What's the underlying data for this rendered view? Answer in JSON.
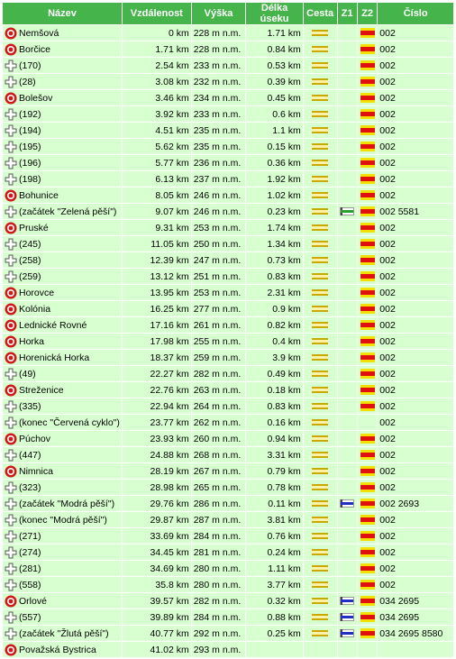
{
  "headers": {
    "nazev": "Název",
    "vzdalenost": "Vzdálenost",
    "vyska": "Výška",
    "delka_useku": "Délka úseku",
    "cesta": "Cesta",
    "z1": "Z1",
    "z2": "Z2",
    "cislo": "Číslo"
  },
  "colors": {
    "header_bg": "#45b44a",
    "row_bg": "#d8ffd0",
    "town_red": "#d01818",
    "road_yellow": "#c9a800",
    "route_red": "#e01010",
    "mark_green": "#2ca02c",
    "mark_blue": "#2030c0",
    "mark_yellow": "#f2e000",
    "mark_red": "#e01010"
  },
  "rows": [
    {
      "icon": "town",
      "name": "Nemšová",
      "distance": "0 km",
      "altitude": "228 m n.m.",
      "segment": "1.71 km",
      "road": true,
      "z1": "",
      "z2": "red",
      "number": "002"
    },
    {
      "icon": "town",
      "name": "Borčice",
      "distance": "1.71 km",
      "altitude": "228 m n.m.",
      "segment": "0.84 km",
      "road": true,
      "z1": "",
      "z2": "red",
      "number": "002"
    },
    {
      "icon": "junction",
      "name": "(170)",
      "distance": "2.54 km",
      "altitude": "233 m n.m.",
      "segment": "0.53 km",
      "road": true,
      "z1": "",
      "z2": "red",
      "number": "002"
    },
    {
      "icon": "junction",
      "name": "(28)",
      "distance": "3.08 km",
      "altitude": "232 m n.m.",
      "segment": "0.39 km",
      "road": true,
      "z1": "",
      "z2": "red",
      "number": "002"
    },
    {
      "icon": "town",
      "name": "Bolešov",
      "distance": "3.46 km",
      "altitude": "234 m n.m.",
      "segment": "0.45 km",
      "road": true,
      "z1": "",
      "z2": "red",
      "number": "002"
    },
    {
      "icon": "junction",
      "name": "(192)",
      "distance": "3.92 km",
      "altitude": "233 m n.m.",
      "segment": "0.6 km",
      "road": true,
      "z1": "",
      "z2": "red",
      "number": "002"
    },
    {
      "icon": "junction",
      "name": "(194)",
      "distance": "4.51 km",
      "altitude": "235 m n.m.",
      "segment": "1.1 km",
      "road": true,
      "z1": "",
      "z2": "red",
      "number": "002"
    },
    {
      "icon": "junction",
      "name": "(195)",
      "distance": "5.62 km",
      "altitude": "235 m n.m.",
      "segment": "0.15 km",
      "road": true,
      "z1": "",
      "z2": "red",
      "number": "002"
    },
    {
      "icon": "junction",
      "name": "(196)",
      "distance": "5.77 km",
      "altitude": "236 m n.m.",
      "segment": "0.36 km",
      "road": true,
      "z1": "",
      "z2": "red",
      "number": "002"
    },
    {
      "icon": "junction",
      "name": "(198)",
      "distance": "6.13 km",
      "altitude": "237 m n.m.",
      "segment": "1.92 km",
      "road": true,
      "z1": "",
      "z2": "red",
      "number": "002"
    },
    {
      "icon": "town",
      "name": "Bohunice",
      "distance": "8.05 km",
      "altitude": "246 m n.m.",
      "segment": "1.02 km",
      "road": true,
      "z1": "",
      "z2": "red",
      "number": "002"
    },
    {
      "icon": "junction",
      "name": "(začátek \"Zelená pěší\")",
      "distance": "9.07 km",
      "altitude": "246 m n.m.",
      "segment": "0.23 km",
      "road": true,
      "z1": "green",
      "z2": "red",
      "number": "002 5581"
    },
    {
      "icon": "town",
      "name": "Pruské",
      "distance": "9.31 km",
      "altitude": "253 m n.m.",
      "segment": "1.74 km",
      "road": true,
      "z1": "",
      "z2": "red",
      "number": "002"
    },
    {
      "icon": "junction",
      "name": "(245)",
      "distance": "11.05 km",
      "altitude": "250 m n.m.",
      "segment": "1.34 km",
      "road": true,
      "z1": "",
      "z2": "red",
      "number": "002"
    },
    {
      "icon": "junction",
      "name": "(258)",
      "distance": "12.39 km",
      "altitude": "247 m n.m.",
      "segment": "0.73 km",
      "road": true,
      "z1": "",
      "z2": "red",
      "number": "002"
    },
    {
      "icon": "junction",
      "name": "(259)",
      "distance": "13.12 km",
      "altitude": "251 m n.m.",
      "segment": "0.83 km",
      "road": true,
      "z1": "",
      "z2": "red",
      "number": "002"
    },
    {
      "icon": "town",
      "name": "Horovce",
      "distance": "13.95 km",
      "altitude": "253 m n.m.",
      "segment": "2.31 km",
      "road": true,
      "z1": "",
      "z2": "red",
      "number": "002"
    },
    {
      "icon": "town",
      "name": "Kolónia",
      "distance": "16.25 km",
      "altitude": "277 m n.m.",
      "segment": "0.9 km",
      "road": true,
      "z1": "",
      "z2": "red",
      "number": "002"
    },
    {
      "icon": "town",
      "name": "Lednické Rovné",
      "distance": "17.16 km",
      "altitude": "261 m n.m.",
      "segment": "0.82 km",
      "road": true,
      "z1": "",
      "z2": "red",
      "number": "002"
    },
    {
      "icon": "town",
      "name": "Horka",
      "distance": "17.98 km",
      "altitude": "255 m n.m.",
      "segment": "0.4 km",
      "road": true,
      "z1": "",
      "z2": "red",
      "number": "002"
    },
    {
      "icon": "town",
      "name": "Horenická Horka",
      "distance": "18.37 km",
      "altitude": "259 m n.m.",
      "segment": "3.9 km",
      "road": true,
      "z1": "",
      "z2": "red",
      "number": "002"
    },
    {
      "icon": "junction",
      "name": "(49)",
      "distance": "22.27 km",
      "altitude": "282 m n.m.",
      "segment": "0.49 km",
      "road": true,
      "z1": "",
      "z2": "red",
      "number": "002"
    },
    {
      "icon": "town",
      "name": "Streženice",
      "distance": "22.76 km",
      "altitude": "263 m n.m.",
      "segment": "0.18 km",
      "road": true,
      "z1": "",
      "z2": "red",
      "number": "002"
    },
    {
      "icon": "junction",
      "name": "(335)",
      "distance": "22.94 km",
      "altitude": "264 m n.m.",
      "segment": "0.83 km",
      "road": true,
      "z1": "",
      "z2": "red",
      "number": "002"
    },
    {
      "icon": "junction",
      "name": "(konec \"Červená cyklo\")",
      "distance": "23.77 km",
      "altitude": "262 m n.m.",
      "segment": "0.16 km",
      "road": true,
      "z1": "",
      "z2": "",
      "number": "002"
    },
    {
      "icon": "town",
      "name": "Púchov",
      "distance": "23.93 km",
      "altitude": "260 m n.m.",
      "segment": "0.94 km",
      "road": true,
      "z1": "",
      "z2": "red",
      "number": "002"
    },
    {
      "icon": "junction",
      "name": "(447)",
      "distance": "24.88 km",
      "altitude": "268 m n.m.",
      "segment": "3.31 km",
      "road": true,
      "z1": "",
      "z2": "red",
      "number": "002"
    },
    {
      "icon": "town",
      "name": "Nimnica",
      "distance": "28.19 km",
      "altitude": "267 m n.m.",
      "segment": "0.79 km",
      "road": true,
      "z1": "",
      "z2": "red",
      "number": "002"
    },
    {
      "icon": "junction",
      "name": "(323)",
      "distance": "28.98 km",
      "altitude": "265 m n.m.",
      "segment": "0.78 km",
      "road": true,
      "z1": "",
      "z2": "red",
      "number": "002"
    },
    {
      "icon": "junction",
      "name": "(začátek \"Modrá pěší\")",
      "distance": "29.76 km",
      "altitude": "286 m n.m.",
      "segment": "0.11 km",
      "road": true,
      "z1": "blue",
      "z2": "red",
      "number": "002 2693"
    },
    {
      "icon": "junction",
      "name": "(konec \"Modrá pěší\")",
      "distance": "29.87 km",
      "altitude": "287 m n.m.",
      "segment": "3.81 km",
      "road": true,
      "z1": "",
      "z2": "red",
      "number": "002"
    },
    {
      "icon": "junction",
      "name": "(271)",
      "distance": "33.69 km",
      "altitude": "284 m n.m.",
      "segment": "0.76 km",
      "road": true,
      "z1": "",
      "z2": "red",
      "number": "002"
    },
    {
      "icon": "junction",
      "name": "(274)",
      "distance": "34.45 km",
      "altitude": "281 m n.m.",
      "segment": "0.24 km",
      "road": true,
      "z1": "",
      "z2": "red",
      "number": "002"
    },
    {
      "icon": "junction",
      "name": "(281)",
      "distance": "34.69 km",
      "altitude": "280 m n.m.",
      "segment": "1.11 km",
      "road": true,
      "z1": "",
      "z2": "red",
      "number": "002"
    },
    {
      "icon": "junction",
      "name": "(558)",
      "distance": "35.8 km",
      "altitude": "280 m n.m.",
      "segment": "3.77 km",
      "road": true,
      "z1": "",
      "z2": "red",
      "number": "002"
    },
    {
      "icon": "town",
      "name": "Orlové",
      "distance": "39.57 km",
      "altitude": "282 m n.m.",
      "segment": "0.32 km",
      "road": true,
      "z1": "blue",
      "z2": "red",
      "number": "034 2695"
    },
    {
      "icon": "junction",
      "name": "(557)",
      "distance": "39.89 km",
      "altitude": "284 m n.m.",
      "segment": "0.88 km",
      "road": true,
      "z1": "blue",
      "z2": "red",
      "number": "034 2695"
    },
    {
      "icon": "junction",
      "name": "(začátek \"Žlutá pěší\")",
      "distance": "40.77 km",
      "altitude": "292 m n.m.",
      "segment": "0.25 km",
      "road": true,
      "z1": "blue",
      "z2": "red",
      "number": "034 2695 8580"
    },
    {
      "icon": "town",
      "name": "Považská Bystrica",
      "distance": "41.02 km",
      "altitude": "293 m n.m.",
      "segment": "",
      "road": false,
      "z1": "",
      "z2": "",
      "number": ""
    }
  ]
}
